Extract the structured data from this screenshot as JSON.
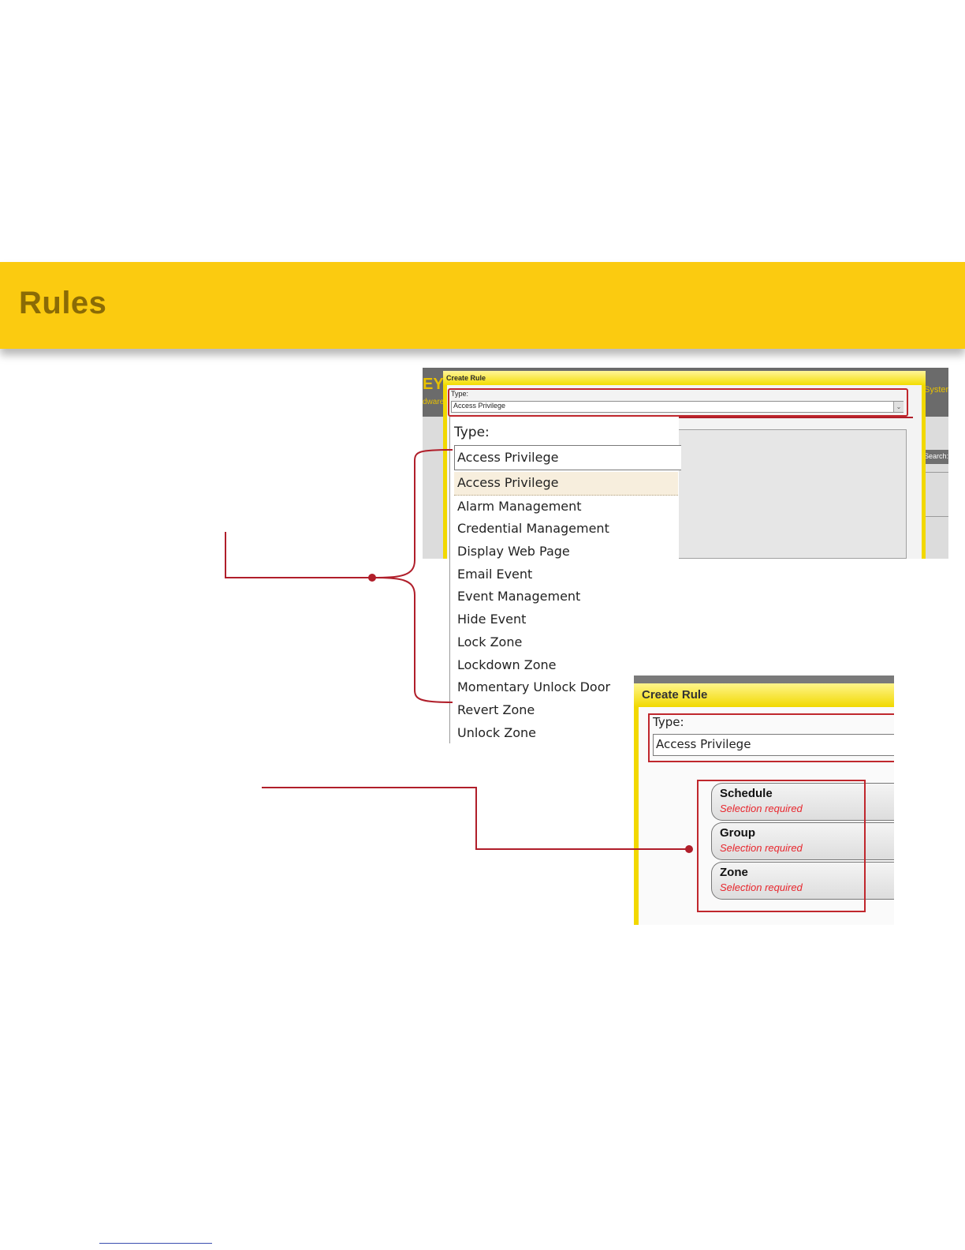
{
  "banner": {
    "title": "Rules"
  },
  "screenshot1": {
    "app_logo_fragment": "EY",
    "app_subtitle_fragment": "dware",
    "system_link_fragment": "System",
    "search_label": "Search:",
    "dialog_title": "Create Rule",
    "type_label": "Type:",
    "type_value": "Access Privilege",
    "arrow_glyph": "⌄"
  },
  "dropdown": {
    "type_label": "Type:",
    "selected_value": "Access Privilege",
    "options": [
      "Access Privilege",
      "Alarm Management",
      "Credential Management",
      "Display Web Page",
      "Email Event",
      "Event Management",
      "Hide Event",
      "Lock Zone",
      "Lockdown Zone",
      "Momentary Unlock Door",
      "Revert Zone",
      "Unlock Zone"
    ],
    "highlighted_index": 0
  },
  "screenshot2": {
    "dialog_title": "Create Rule",
    "type_label": "Type:",
    "type_value": "Access Privilege",
    "requirements": [
      {
        "title": "Schedule",
        "status": "Selection required"
      },
      {
        "title": "Group",
        "status": "Selection required"
      },
      {
        "title": "Zone",
        "status": "Selection required"
      }
    ]
  },
  "colors": {
    "banner": "#fbcb10",
    "banner_text": "#8a6b06",
    "callout": "#b01e2a",
    "required_text": "#e8262d"
  }
}
